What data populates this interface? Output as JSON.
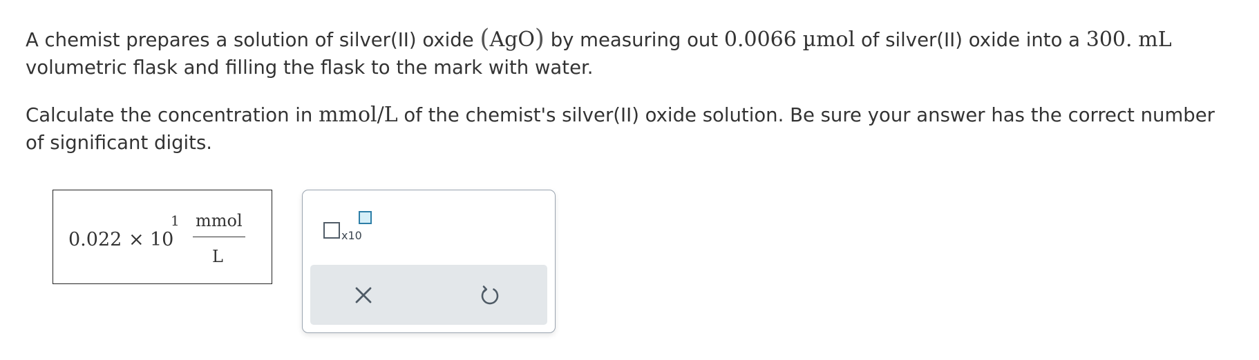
{
  "question": {
    "p1": {
      "t1": "A chemist prepares a solution of silver(II) oxide ",
      "open_paren": "(",
      "formula": "AgO",
      "close_paren": ")",
      "t2": " by measuring out ",
      "amount": "0.0066",
      "amount_unit": "µmol",
      "t3": " of silver(II) oxide into a ",
      "volume": "300.",
      "volume_unit": "mL",
      "line2": "volumetric flask and filling the flask to the mark with water."
    },
    "p2": {
      "t1": "Calculate the concentration in ",
      "unit": "mmol/L",
      "t2": " of the chemist's silver(II) oxide solution. Be sure your answer has the correct number",
      "line2": "of significant digits."
    }
  },
  "answer": {
    "coefficient": "0.022",
    "times": "×",
    "base": "10",
    "exponent": "1",
    "unit_numerator": "mmol",
    "unit_denominator": "L"
  },
  "toolbar": {
    "x10_label": "x10"
  },
  "icons": {
    "scientific_notation": "x10-icon",
    "clear": "close-icon",
    "undo": "undo-icon"
  },
  "colors": {
    "text": "#333333",
    "panel_border": "#9aa4b0",
    "footer_bg": "#e3e7ea",
    "icon": "#4f5b66",
    "accent": "#2d7ea7"
  }
}
